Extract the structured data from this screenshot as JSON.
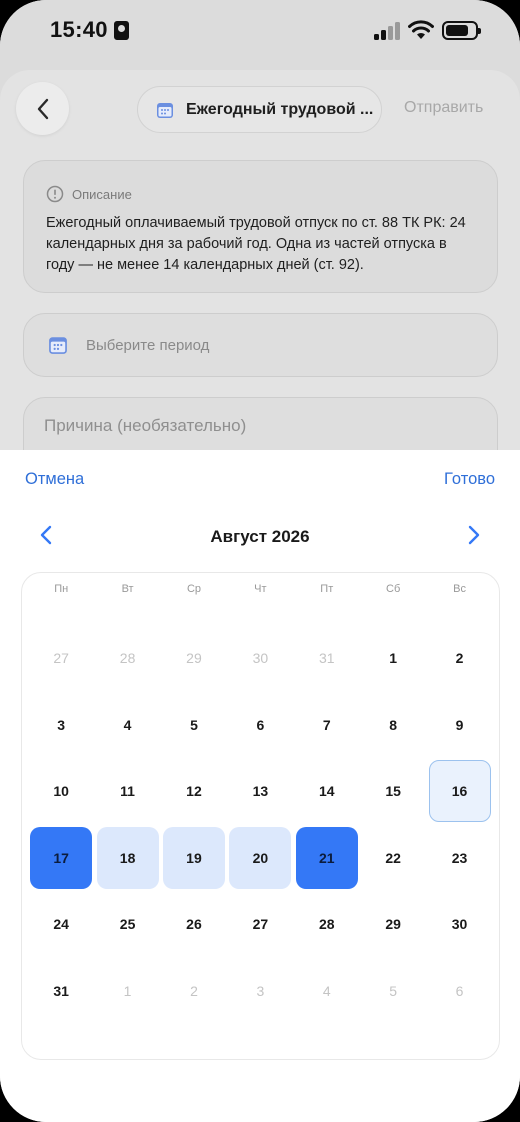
{
  "status": {
    "time": "15:40"
  },
  "header": {
    "title": "Ежегодный трудовой ...",
    "send_label": "Отправить"
  },
  "description": {
    "label": "Описание",
    "text": "Ежегодный оплачиваемый трудовой отпуск по ст. 88 ТК РК: 24 календарных дня за рабочий год. Одна из частей отпуска в году — не менее 14 календарных дней (ст. 92)."
  },
  "period": {
    "placeholder": "Выберите период"
  },
  "reason": {
    "placeholder": "Причина (необязательно)"
  },
  "picker": {
    "cancel_label": "Отмена",
    "done_label": "Готово",
    "month_title": "Август 2026",
    "weekdays": [
      "Пн",
      "Вт",
      "Ср",
      "Чт",
      "Пт",
      "Сб",
      "Вс"
    ],
    "weeks": [
      [
        {
          "d": "27",
          "t": "other"
        },
        {
          "d": "28",
          "t": "other"
        },
        {
          "d": "29",
          "t": "other"
        },
        {
          "d": "30",
          "t": "other"
        },
        {
          "d": "31",
          "t": "other"
        },
        {
          "d": "1",
          "t": ""
        },
        {
          "d": "2",
          "t": ""
        }
      ],
      [
        {
          "d": "3",
          "t": ""
        },
        {
          "d": "4",
          "t": ""
        },
        {
          "d": "5",
          "t": ""
        },
        {
          "d": "6",
          "t": ""
        },
        {
          "d": "7",
          "t": ""
        },
        {
          "d": "8",
          "t": ""
        },
        {
          "d": "9",
          "t": ""
        }
      ],
      [
        {
          "d": "10",
          "t": ""
        },
        {
          "d": "11",
          "t": ""
        },
        {
          "d": "12",
          "t": ""
        },
        {
          "d": "13",
          "t": ""
        },
        {
          "d": "14",
          "t": ""
        },
        {
          "d": "15",
          "t": ""
        },
        {
          "d": "16",
          "t": "today"
        }
      ],
      [
        {
          "d": "17",
          "t": "sel"
        },
        {
          "d": "18",
          "t": "range"
        },
        {
          "d": "19",
          "t": "range"
        },
        {
          "d": "20",
          "t": "range"
        },
        {
          "d": "21",
          "t": "sel"
        },
        {
          "d": "22",
          "t": ""
        },
        {
          "d": "23",
          "t": ""
        }
      ],
      [
        {
          "d": "24",
          "t": ""
        },
        {
          "d": "25",
          "t": ""
        },
        {
          "d": "26",
          "t": ""
        },
        {
          "d": "27",
          "t": ""
        },
        {
          "d": "28",
          "t": ""
        },
        {
          "d": "29",
          "t": ""
        },
        {
          "d": "30",
          "t": ""
        }
      ],
      [
        {
          "d": "31",
          "t": ""
        },
        {
          "d": "1",
          "t": "other"
        },
        {
          "d": "2",
          "t": "other"
        },
        {
          "d": "3",
          "t": "other"
        },
        {
          "d": "4",
          "t": "other"
        },
        {
          "d": "5",
          "t": "other"
        },
        {
          "d": "6",
          "t": "other"
        }
      ]
    ]
  },
  "colors": {
    "accent": "#3478f6",
    "link": "#2f6fd8",
    "range": "#dce8fc"
  }
}
